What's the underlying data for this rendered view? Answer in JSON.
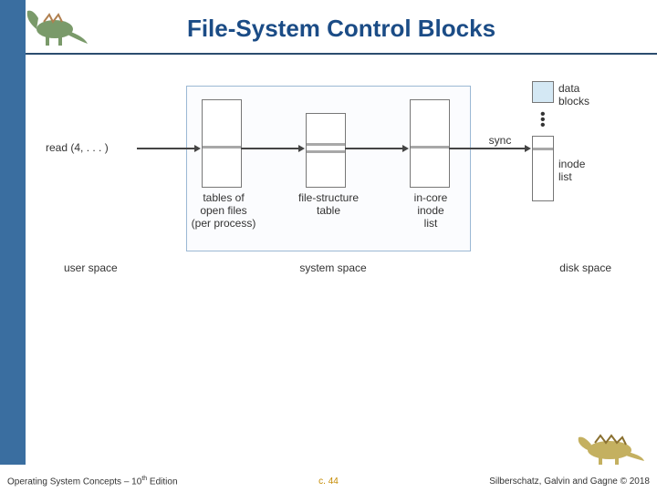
{
  "header": {
    "title": "File-System Control Blocks"
  },
  "footer": {
    "left": "Operating System Concepts – 10th Edition",
    "center": "c. 44",
    "right": "Silberschatz, Galvin and Gagne © 2018"
  },
  "diagram": {
    "read_call": "read (4, . . . )",
    "labels": {
      "tables_of_open_files": "tables of\nopen files\n(per process)",
      "file_structure_table": "file-structure\ntable",
      "in_core_inode_list": "in-core\ninode\nlist",
      "data_blocks": "data\nblocks",
      "inode_list": "inode\nlist",
      "sync": "sync",
      "user_space": "user space",
      "system_space": "system space",
      "disk_space": "disk space"
    }
  }
}
